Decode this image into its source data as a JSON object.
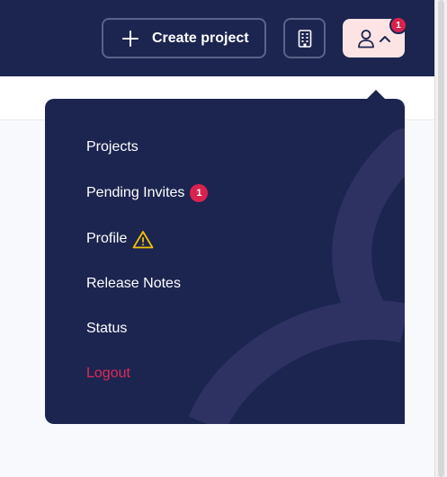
{
  "header": {
    "create_project_label": "Create project",
    "user_notification_count": "1",
    "icons": {
      "create": "plus-icon",
      "organization": "building-icon",
      "user": "user-icon",
      "caret": "chevron-up-icon"
    }
  },
  "user_menu": {
    "items": [
      {
        "label": "Projects"
      },
      {
        "label": "Pending Invites",
        "badge": "1"
      },
      {
        "label": "Profile",
        "icon": "warning-icon"
      },
      {
        "label": "Release Notes"
      },
      {
        "label": "Status"
      },
      {
        "label": "Logout"
      }
    ]
  },
  "colors": {
    "navy": "#1c2550",
    "accent_red": "#d9234f",
    "logout_red": "#e0295a",
    "user_button_bg": "#fde4e4",
    "warning_yellow": "#f2c200"
  }
}
